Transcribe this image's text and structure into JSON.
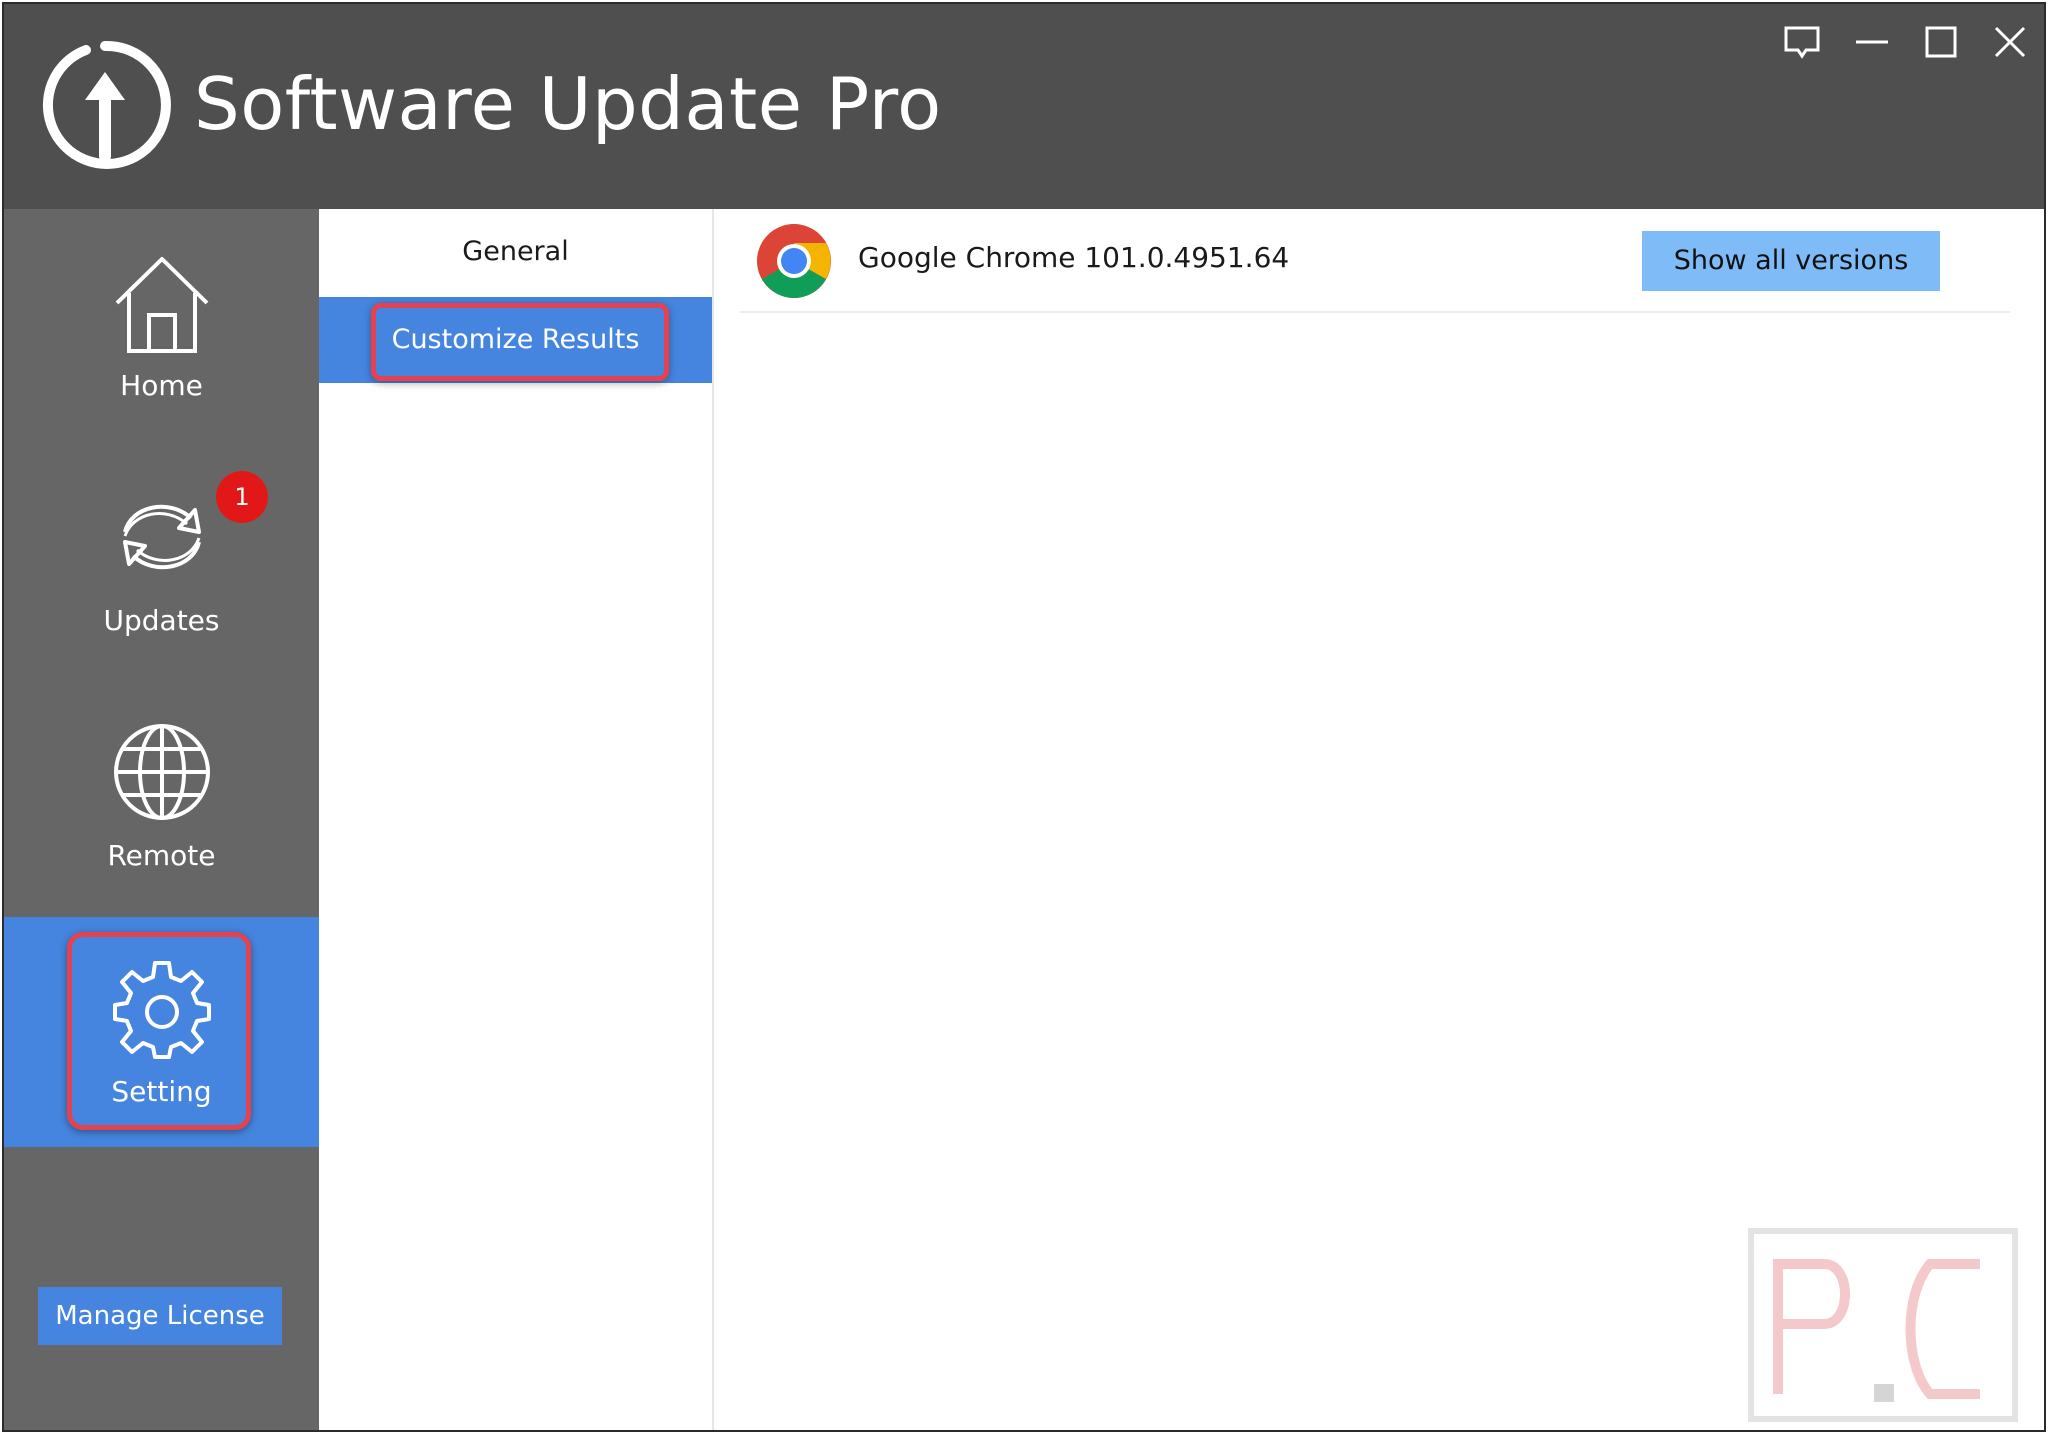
{
  "app": {
    "title": "Software Update Pro"
  },
  "titlebar": {
    "buttons": [
      "feedback-icon",
      "minimize-icon",
      "maximize-icon",
      "close-icon"
    ]
  },
  "sidebar": {
    "items": [
      {
        "label": "Home",
        "icon": "home-icon"
      },
      {
        "label": "Updates",
        "icon": "refresh-icon",
        "badge": "1"
      },
      {
        "label": "Remote",
        "icon": "globe-icon"
      },
      {
        "label": "Setting",
        "icon": "gear-icon",
        "active": true
      }
    ],
    "manage_license_label": "Manage License"
  },
  "settings_nav": {
    "items": [
      {
        "label": "General",
        "active": false
      },
      {
        "label": "Customize Results",
        "active": true
      }
    ]
  },
  "results": [
    {
      "icon": "chrome-icon",
      "name": "Google Chrome 101.0.4951.64",
      "action_label": "Show all versions"
    }
  ],
  "colors": {
    "titlebar": "#4f4f4f",
    "sidebar": "#666666",
    "accent": "#4585e0",
    "button_light_blue": "#7fbcf7",
    "badge_red": "#e21818",
    "highlight_red": "#e5424f"
  }
}
